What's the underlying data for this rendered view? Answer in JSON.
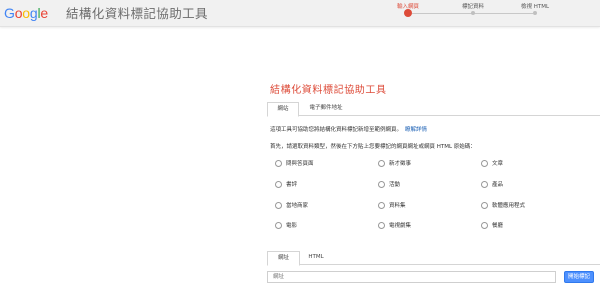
{
  "header": {
    "logo": {
      "letters": [
        {
          "ch": "G",
          "color": "#4285f4"
        },
        {
          "ch": "o",
          "color": "#ea4335"
        },
        {
          "ch": "o",
          "color": "#fbbc05"
        },
        {
          "ch": "g",
          "color": "#4285f4"
        },
        {
          "ch": "l",
          "color": "#34a853"
        },
        {
          "ch": "e",
          "color": "#ea4335"
        }
      ]
    },
    "app_title": "結構化資料標記協助工具"
  },
  "stepper": {
    "steps": [
      {
        "label": "輸入網頁",
        "state": "active"
      },
      {
        "label": "標記資料",
        "state": "inactive"
      },
      {
        "label": "檢視 HTML",
        "state": "inactive"
      }
    ],
    "accent_color": "#dd4b39"
  },
  "main": {
    "title": "結構化資料標記協助工具",
    "tabs": [
      {
        "label": "網站",
        "active": true
      },
      {
        "label": "電子郵件地址",
        "active": false
      }
    ],
    "description": "這項工具可協助您將結構化資料標記新增至範例網頁。",
    "learn_more": "瞭解詳情",
    "instruction": "首先，請選取資料類型，然後在下方貼上您要標記的網頁網址或網頁 HTML 原始碼：",
    "data_types": [
      {
        "label": "問與答頁面",
        "selected": false
      },
      {
        "label": "新才徵事",
        "selected": false
      },
      {
        "label": "文章",
        "selected": false
      },
      {
        "label": "書評",
        "selected": false
      },
      {
        "label": "活動",
        "selected": false
      },
      {
        "label": "產品",
        "selected": false
      },
      {
        "label": "當地商家",
        "selected": false
      },
      {
        "label": "資料集",
        "selected": false
      },
      {
        "label": "軟體應用程式",
        "selected": false
      },
      {
        "label": "電影",
        "selected": false
      },
      {
        "label": "電視劇集",
        "selected": false
      },
      {
        "label": "餐廳",
        "selected": false
      }
    ]
  },
  "source": {
    "tabs": [
      {
        "label": "網址",
        "active": true
      },
      {
        "label": "HTML",
        "active": false
      }
    ],
    "url_placeholder": "網址",
    "url_value": "",
    "start_button": "開始標記"
  }
}
